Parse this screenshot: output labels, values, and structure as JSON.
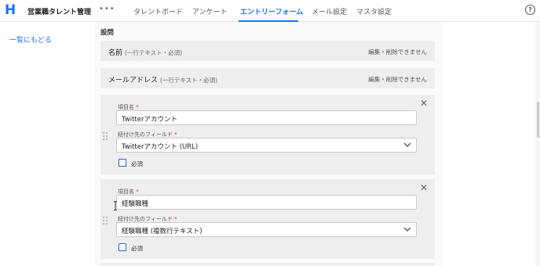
{
  "header": {
    "logo": "H",
    "app_title": "営業職タレント管理",
    "more": "•••",
    "tabs": [
      {
        "label": "タレントボード",
        "active": false
      },
      {
        "label": "アンケート",
        "active": false
      },
      {
        "label": "エントリーフォーム",
        "active": true
      },
      {
        "label": "メール設定",
        "active": false
      },
      {
        "label": "マスタ設定",
        "active": false
      }
    ],
    "help": "?"
  },
  "sidebar": {
    "back_label": "一覧にもどる"
  },
  "main": {
    "section_label": "設問",
    "fixed_fields": [
      {
        "name": "名前",
        "meta": "(一行テキスト・必須)",
        "note": "編集・削除できません"
      },
      {
        "name": "メールアドレス",
        "meta": "(一行テキスト・必須)",
        "note": "編集・削除できません"
      }
    ],
    "cards": [
      {
        "item_label": "項目名",
        "required_mark": "*",
        "item_value": "Twitterアカウント",
        "field_label": "紐付け先のフィールド",
        "field_value": "Twitterアカウント (URL)",
        "required_label": "必須",
        "required_checked": false,
        "close": "✕"
      },
      {
        "item_label": "項目名",
        "required_mark": "*",
        "item_value": "経験職種",
        "field_label": "紐付け先のフィールド",
        "field_value": "経験職種 (複数行テキスト)",
        "required_label": "必須",
        "required_checked": false,
        "close": "✕"
      }
    ]
  },
  "icons": {
    "logo": "h-logo-icon",
    "more": "more-horizontal-icon",
    "help": "help-circle-icon",
    "close": "close-icon",
    "chevron": "chevron-down-icon",
    "drag": "drag-handle-icon"
  },
  "colors": {
    "accent": "#1a73e8",
    "checkbox_border": "#2d64c8",
    "required_mark": "#d33333",
    "card_bg": "#eeeeee"
  }
}
